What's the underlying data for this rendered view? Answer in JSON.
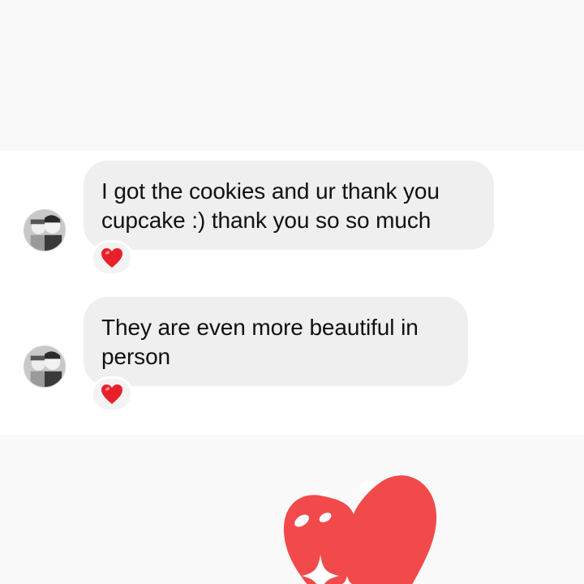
{
  "messages": [
    {
      "text_line1": "I got the cookies and ur thank you",
      "text_line2": "cupcake :) thank you so so much",
      "reaction": "heart-icon"
    },
    {
      "text_line1": "They are even more beautiful in",
      "text_line2": "person",
      "reaction": "heart-icon"
    }
  ],
  "colors": {
    "bubble": "#efefef",
    "reaction_heart": "#e8202a",
    "big_heart": "#f24a4a",
    "background": "#f9f9f9",
    "chat_background": "#ffffff"
  },
  "decoration": {
    "icon": "sparkle-heart-icon"
  }
}
